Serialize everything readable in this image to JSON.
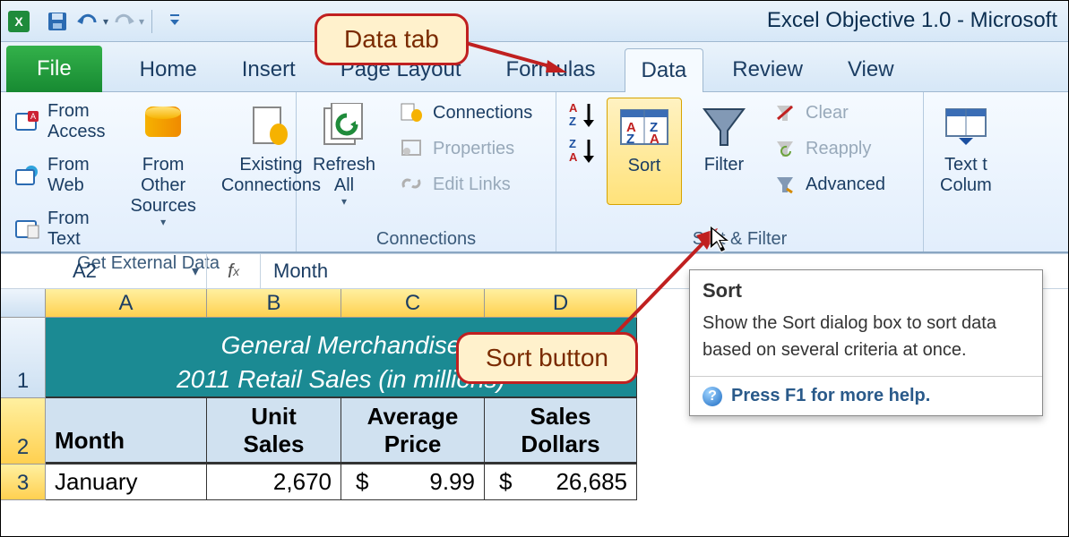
{
  "app_title": "Excel Objective 1.0 - Microsoft",
  "qat": {
    "save": "save",
    "undo": "undo",
    "redo": "redo"
  },
  "tabs": {
    "file": "File",
    "home": "Home",
    "insert": "Insert",
    "page_layout": "Page Layout",
    "formulas": "Formulas",
    "data": "Data",
    "review": "Review",
    "view": "View"
  },
  "ribbon": {
    "get_external": {
      "from_access": "From Access",
      "from_web": "From Web",
      "from_text": "From Text",
      "from_other": "From Other\nSources",
      "existing": "Existing\nConnections",
      "title": "Get External Data"
    },
    "connections": {
      "refresh": "Refresh\nAll",
      "connections": "Connections",
      "properties": "Properties",
      "edit_links": "Edit Links",
      "title": "Connections"
    },
    "sort_filter": {
      "sort": "Sort",
      "filter": "Filter",
      "clear": "Clear",
      "reapply": "Reapply",
      "advanced": "Advanced",
      "title": "Sort & Filter"
    },
    "text_to": "Text t\nColum"
  },
  "namebox": "A2",
  "formula": "Month",
  "columns": [
    "A",
    "B",
    "C",
    "D"
  ],
  "rows": [
    "1",
    "2",
    "3"
  ],
  "sheet_title": "General Merchandise\n2011 Retail Sales (in millions)",
  "headers": {
    "a": "Month",
    "b": "Unit\nSales",
    "c": "Average\nPrice",
    "d": "Sales\nDollars"
  },
  "data_row": {
    "month": "January",
    "unit": "2,670",
    "price": "9.99",
    "dollars": "26,685",
    "cur": "$"
  },
  "callouts": {
    "data_tab": "Data tab",
    "sort_button": "Sort button"
  },
  "tooltip": {
    "title": "Sort",
    "body": "Show the Sort dialog box to sort data based on several criteria at once.",
    "help": "Press F1 for more help."
  }
}
